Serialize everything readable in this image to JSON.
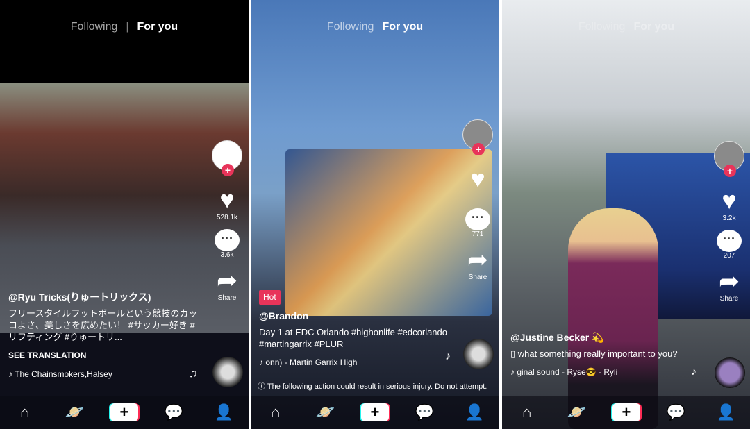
{
  "tabs": {
    "following": "Following",
    "for_you": "For you"
  },
  "accent": "#e8345a",
  "panels": [
    {
      "username": "@Ryu Tricks(りゅートリックス)",
      "caption": "フリースタイルフットボールという競技のカッコよさ、美しさを広めたい！ #サッカー好き #リフティング #りゅートリ...",
      "see_translation": "SEE TRANSLATION",
      "music": "The Chainsmokers,Halsey",
      "likes": "528.1k",
      "comments": "3.6k",
      "share": "Share"
    },
    {
      "badge": "Hot",
      "username": "@Brandon",
      "caption": "Day 1 at EDC Orlando #highonlife #edcorlando #martingarrix #PLUR",
      "music": "onn) - Martin Garrix   High",
      "likes": "",
      "comments": "771",
      "share": "Share",
      "warning": "The following action could result in serious injury. Do not attempt."
    },
    {
      "username": "@Justine Becker 💫",
      "caption": "▯ what something really important to you?",
      "music": "ginal sound - Ryse😎 - Ryli",
      "likes": "3.2k",
      "comments": "207",
      "share": "Share"
    }
  ],
  "nav_icons": [
    "home-icon",
    "discover-icon",
    "create-icon",
    "inbox-icon",
    "profile-icon"
  ],
  "nav_add": "+"
}
